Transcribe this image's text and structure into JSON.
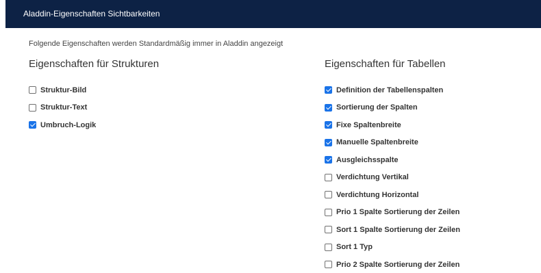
{
  "header": {
    "title": "Aladdin-Eigenschaften Sichtbarkeiten",
    "background": "#0d2245"
  },
  "intro_text": "Folgende Eigenschaften werden Standardmäßig immer in Aladdin angezeigt",
  "accent_color": "#1a73e8",
  "structures": {
    "heading": "Eigenschaften für Strukturen",
    "options": [
      {
        "label": "Struktur-Bild",
        "checked": false
      },
      {
        "label": "Struktur-Text",
        "checked": false
      },
      {
        "label": "Umbruch-Logik",
        "checked": true
      }
    ]
  },
  "tables": {
    "heading": "Eigenschaften für Tabellen",
    "options": [
      {
        "label": "Definition der Tabellenspalten",
        "checked": true
      },
      {
        "label": "Sortierung der Spalten",
        "checked": true
      },
      {
        "label": "Fixe Spaltenbreite",
        "checked": true
      },
      {
        "label": "Manuelle Spaltenbreite",
        "checked": true
      },
      {
        "label": "Ausgleichsspalte",
        "checked": true
      },
      {
        "label": "Verdichtung Vertikal",
        "checked": false
      },
      {
        "label": "Verdichtung Horizontal",
        "checked": false
      },
      {
        "label": "Prio 1 Spalte Sortierung der Zeilen",
        "checked": false
      },
      {
        "label": "Sort 1 Spalte Sortierung der Zeilen",
        "checked": false
      },
      {
        "label": "Sort 1 Typ",
        "checked": false
      },
      {
        "label": "Prio 2 Spalte Sortierung der Zeilen",
        "checked": false
      }
    ]
  }
}
